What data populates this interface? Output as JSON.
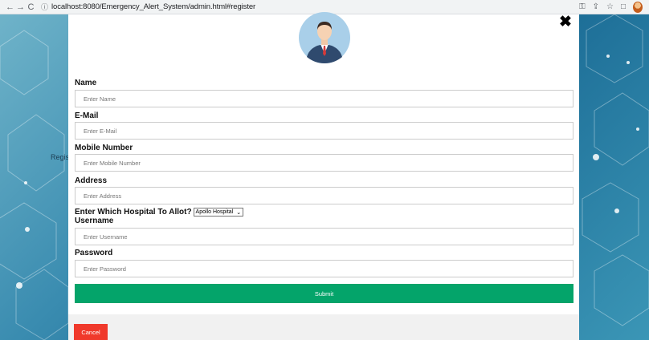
{
  "browser": {
    "url": "localhost:8080/Emergency_Alert_System/admin.html#register"
  },
  "background": {
    "partial_text": "Regis"
  },
  "form": {
    "fields": [
      {
        "label": "Name",
        "placeholder": "Enter Name"
      },
      {
        "label": "E-Mail",
        "placeholder": "Enter E-Mail"
      },
      {
        "label": "Mobile Number",
        "placeholder": "Enter Mobile Number"
      },
      {
        "label": "Address",
        "placeholder": "Enter Address"
      },
      {
        "label": "Username",
        "placeholder": "Enter Username"
      },
      {
        "label": "Password",
        "placeholder": "Enter Password"
      }
    ],
    "hospital": {
      "label": "Enter Which Hospital To Allot?",
      "selected": "Apollo Hospital"
    },
    "submit_label": "Submit",
    "cancel_label": "Cancel",
    "close_glyph": "✖"
  },
  "colors": {
    "submit": "#04a46a",
    "cancel": "#f0392b"
  }
}
